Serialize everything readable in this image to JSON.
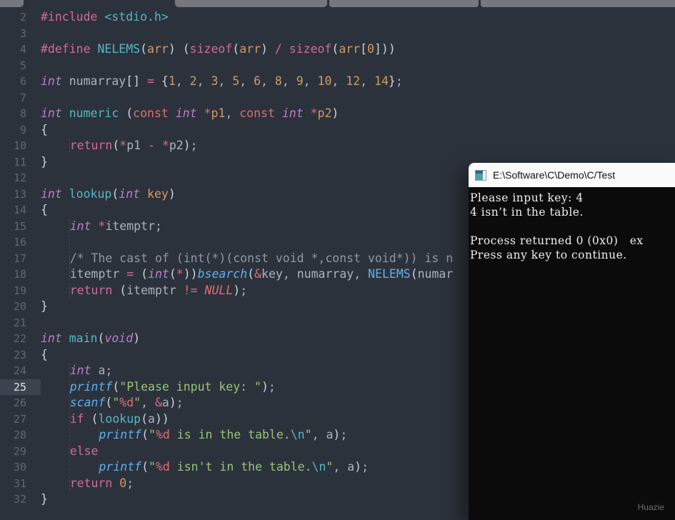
{
  "palette": {
    "editor_background": "#2c323c",
    "tabstrip_gray": "#75797f",
    "keyword_pink": "#d2699e",
    "type_purple": "#bc7ecb",
    "salmon_red": "#e06c75",
    "function_teal": "#56b6c2",
    "library_blue": "#61afef",
    "string_green": "#98c379",
    "number_orange": "#d19a66",
    "comment_gray": "#9198a3",
    "gutter_number": "#5e6773",
    "active_line_bg": "#3b434f",
    "console_background": "#0b0b0b",
    "console_text": "#efefef",
    "console_titlebar": "#fbfbfb"
  },
  "editor": {
    "active_line": "25",
    "lines": [
      {
        "n": "2",
        "seg": [
          [
            "k",
            "#include"
          ],
          [
            "p",
            " "
          ],
          [
            "f",
            "<stdio.h>"
          ]
        ]
      },
      {
        "n": "3",
        "seg": []
      },
      {
        "n": "4",
        "seg": [
          [
            "k",
            "#define"
          ],
          [
            "p",
            " "
          ],
          [
            "f",
            "NELEMS"
          ],
          [
            "b",
            "("
          ],
          [
            "n",
            "arr"
          ],
          [
            "b",
            ")"
          ],
          [
            "p",
            " "
          ],
          [
            "b",
            "("
          ],
          [
            "k",
            "sizeof"
          ],
          [
            "b",
            "("
          ],
          [
            "n",
            "arr"
          ],
          [
            "b",
            ")"
          ],
          [
            "p",
            " "
          ],
          [
            "k",
            "/"
          ],
          [
            "p",
            " "
          ],
          [
            "k",
            "sizeof"
          ],
          [
            "b",
            "("
          ],
          [
            "n",
            "arr"
          ],
          [
            "b",
            "["
          ],
          [
            "n",
            "0"
          ],
          [
            "b",
            "]))"
          ]
        ]
      },
      {
        "n": "5",
        "seg": []
      },
      {
        "n": "6",
        "seg": [
          [
            "t",
            "int"
          ],
          [
            "p",
            " "
          ],
          [
            "p",
            "numarray"
          ],
          [
            "b",
            "[]"
          ],
          [
            "p",
            " "
          ],
          [
            "k",
            "="
          ],
          [
            "p",
            " "
          ],
          [
            "b",
            "{"
          ],
          [
            "n",
            "1"
          ],
          [
            "p",
            ", "
          ],
          [
            "n",
            "2"
          ],
          [
            "p",
            ", "
          ],
          [
            "n",
            "3"
          ],
          [
            "p",
            ", "
          ],
          [
            "n",
            "5"
          ],
          [
            "p",
            ", "
          ],
          [
            "n",
            "6"
          ],
          [
            "p",
            ", "
          ],
          [
            "n",
            "8"
          ],
          [
            "p",
            ", "
          ],
          [
            "n",
            "9"
          ],
          [
            "p",
            ", "
          ],
          [
            "n",
            "10"
          ],
          [
            "p",
            ", "
          ],
          [
            "n",
            "12"
          ],
          [
            "p",
            ", "
          ],
          [
            "n",
            "14"
          ],
          [
            "b",
            "}"
          ],
          [
            "p",
            ";"
          ]
        ]
      },
      {
        "n": "7",
        "seg": []
      },
      {
        "n": "8",
        "seg": [
          [
            "t",
            "int"
          ],
          [
            "p",
            " "
          ],
          [
            "f",
            "numeric"
          ],
          [
            "p",
            " "
          ],
          [
            "b",
            "("
          ],
          [
            "r",
            "const"
          ],
          [
            "p",
            " "
          ],
          [
            "t",
            "int"
          ],
          [
            "p",
            " "
          ],
          [
            "r",
            "*"
          ],
          [
            "n",
            "p1"
          ],
          [
            "p",
            ", "
          ],
          [
            "r",
            "const"
          ],
          [
            "p",
            " "
          ],
          [
            "t",
            "int"
          ],
          [
            "p",
            " "
          ],
          [
            "r",
            "*"
          ],
          [
            "n",
            "p2"
          ],
          [
            "b",
            ")"
          ]
        ]
      },
      {
        "n": "9",
        "seg": [
          [
            "b",
            "{"
          ]
        ]
      },
      {
        "n": "10",
        "seg": [
          [
            "i",
            "    "
          ],
          [
            "k",
            "return"
          ],
          [
            "b",
            "("
          ],
          [
            "r",
            "*"
          ],
          [
            "p",
            "p1"
          ],
          [
            "p",
            " "
          ],
          [
            "k",
            "-"
          ],
          [
            "p",
            " "
          ],
          [
            "r",
            "*"
          ],
          [
            "p",
            "p2"
          ],
          [
            "b",
            ")"
          ],
          [
            "p",
            ";"
          ]
        ]
      },
      {
        "n": "11",
        "seg": [
          [
            "b",
            "}"
          ]
        ]
      },
      {
        "n": "12",
        "seg": []
      },
      {
        "n": "13",
        "seg": [
          [
            "t",
            "int"
          ],
          [
            "p",
            " "
          ],
          [
            "f",
            "lookup"
          ],
          [
            "b",
            "("
          ],
          [
            "t",
            "int"
          ],
          [
            "p",
            " "
          ],
          [
            "n",
            "key"
          ],
          [
            "b",
            ")"
          ]
        ]
      },
      {
        "n": "14",
        "seg": [
          [
            "b",
            "{"
          ]
        ]
      },
      {
        "n": "15",
        "seg": [
          [
            "i",
            "    "
          ],
          [
            "t",
            "int"
          ],
          [
            "p",
            " "
          ],
          [
            "r",
            "*"
          ],
          [
            "p",
            "itemptr"
          ],
          [
            "p",
            ";"
          ]
        ]
      },
      {
        "n": "16",
        "seg": [
          [
            "i",
            "    "
          ]
        ]
      },
      {
        "n": "17",
        "seg": [
          [
            "i",
            "    "
          ],
          [
            "c",
            "/* The cast of (int(*)(const void *,const void*)) is n"
          ]
        ]
      },
      {
        "n": "18",
        "seg": [
          [
            "i",
            "    "
          ],
          [
            "p",
            "itemptr"
          ],
          [
            "p",
            " "
          ],
          [
            "k",
            "="
          ],
          [
            "p",
            " "
          ],
          [
            "b",
            "("
          ],
          [
            "t",
            "int"
          ],
          [
            "b",
            "("
          ],
          [
            "r",
            "*"
          ],
          [
            "b",
            "))"
          ],
          [
            "l",
            "bsearch"
          ],
          [
            "b",
            "("
          ],
          [
            "r",
            "&"
          ],
          [
            "p",
            "key"
          ],
          [
            "p",
            ", "
          ],
          [
            "p",
            "numarray"
          ],
          [
            "p",
            ", "
          ],
          [
            "lu",
            "NELEMS"
          ],
          [
            "b",
            "("
          ],
          [
            "p",
            "numar"
          ]
        ]
      },
      {
        "n": "19",
        "seg": [
          [
            "i",
            "    "
          ],
          [
            "k",
            "return"
          ],
          [
            "p",
            " "
          ],
          [
            "b",
            "("
          ],
          [
            "p",
            "itemptr"
          ],
          [
            "p",
            " "
          ],
          [
            "r",
            "!="
          ],
          [
            "p",
            " "
          ],
          [
            "ri",
            "NULL"
          ],
          [
            "b",
            ")"
          ],
          [
            "p",
            ";"
          ]
        ]
      },
      {
        "n": "20",
        "seg": [
          [
            "b",
            "}"
          ]
        ]
      },
      {
        "n": "21",
        "seg": []
      },
      {
        "n": "22",
        "seg": [
          [
            "t",
            "int"
          ],
          [
            "p",
            " "
          ],
          [
            "f",
            "main"
          ],
          [
            "b",
            "("
          ],
          [
            "t",
            "void"
          ],
          [
            "b",
            ")"
          ]
        ]
      },
      {
        "n": "23",
        "seg": [
          [
            "b",
            "{"
          ]
        ]
      },
      {
        "n": "24",
        "seg": [
          [
            "i",
            "    "
          ],
          [
            "t",
            "int"
          ],
          [
            "p",
            " "
          ],
          [
            "p",
            "a"
          ],
          [
            "p",
            ";"
          ]
        ]
      },
      {
        "n": "25",
        "hl": true,
        "seg": [
          [
            "i",
            "    "
          ],
          [
            "l",
            "printf"
          ],
          [
            "b",
            "("
          ],
          [
            "s",
            "\"Please input key: \""
          ],
          [
            "b",
            ")"
          ],
          [
            "p",
            ";"
          ]
        ]
      },
      {
        "n": "26",
        "seg": [
          [
            "i",
            "    "
          ],
          [
            "l",
            "scanf"
          ],
          [
            "b",
            "("
          ],
          [
            "s",
            "\""
          ],
          [
            "r",
            "%d"
          ],
          [
            "s",
            "\""
          ],
          [
            "p",
            ", "
          ],
          [
            "r",
            "&"
          ],
          [
            "p",
            "a"
          ],
          [
            "b",
            ")"
          ],
          [
            "p",
            ";"
          ]
        ]
      },
      {
        "n": "27",
        "seg": [
          [
            "i",
            "    "
          ],
          [
            "k",
            "if"
          ],
          [
            "p",
            " "
          ],
          [
            "b",
            "("
          ],
          [
            "f",
            "lookup"
          ],
          [
            "b",
            "("
          ],
          [
            "p",
            "a"
          ],
          [
            "b",
            "))"
          ]
        ]
      },
      {
        "n": "28",
        "seg": [
          [
            "i",
            "    "
          ],
          [
            "i",
            "    "
          ],
          [
            "l",
            "printf"
          ],
          [
            "b",
            "("
          ],
          [
            "s",
            "\""
          ],
          [
            "r",
            "%d"
          ],
          [
            "s",
            " is in the table."
          ],
          [
            "e",
            "\\n"
          ],
          [
            "s",
            "\""
          ],
          [
            "p",
            ", "
          ],
          [
            "p",
            "a"
          ],
          [
            "b",
            ")"
          ],
          [
            "p",
            ";"
          ]
        ]
      },
      {
        "n": "29",
        "seg": [
          [
            "i",
            "    "
          ],
          [
            "k",
            "else"
          ]
        ]
      },
      {
        "n": "30",
        "seg": [
          [
            "i",
            "    "
          ],
          [
            "i",
            "    "
          ],
          [
            "l",
            "printf"
          ],
          [
            "b",
            "("
          ],
          [
            "s",
            "\""
          ],
          [
            "r",
            "%d"
          ],
          [
            "s",
            " isn't in the table."
          ],
          [
            "e",
            "\\n"
          ],
          [
            "s",
            "\""
          ],
          [
            "p",
            ", "
          ],
          [
            "p",
            "a"
          ],
          [
            "b",
            ")"
          ],
          [
            "p",
            ";"
          ]
        ]
      },
      {
        "n": "31",
        "seg": [
          [
            "i",
            "    "
          ],
          [
            "k",
            "return"
          ],
          [
            "p",
            " "
          ],
          [
            "n",
            "0"
          ],
          [
            "p",
            ";"
          ]
        ]
      },
      {
        "n": "32",
        "seg": [
          [
            "b",
            "}"
          ]
        ]
      }
    ]
  },
  "console": {
    "title": "E:\\Software\\C\\Demo\\C/Test",
    "icon": "console-window-icon",
    "output_lines": [
      "Please input key: 4",
      "4 isn’t in the table.",
      "",
      "Process returned 0 (0x0)   ex",
      "Press any key to continue."
    ],
    "watermark": "Huazie"
  }
}
